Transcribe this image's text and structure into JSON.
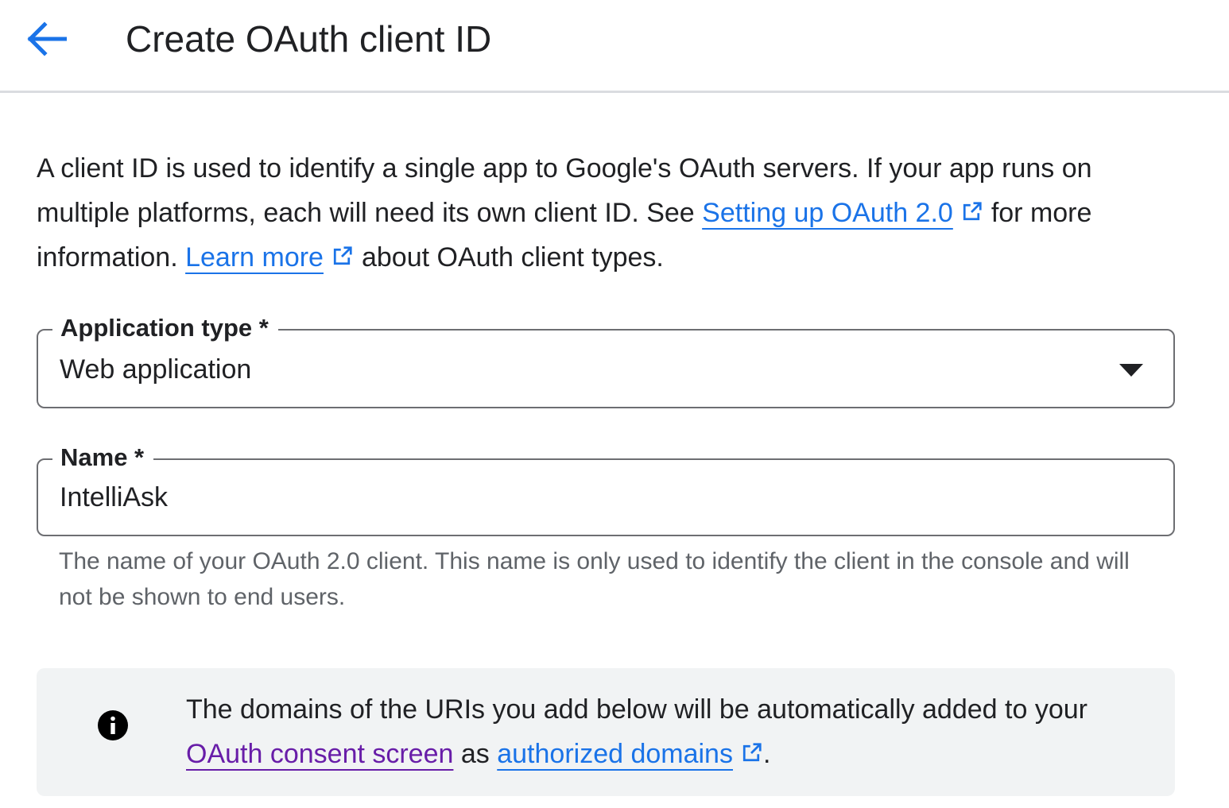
{
  "header": {
    "title": "Create OAuth client ID"
  },
  "intro": {
    "text_1": "A client ID is used to identify a single app to Google's OAuth servers. If your app runs on multiple platforms, each will need its own client ID. See ",
    "link_setup": "Setting up OAuth 2.0",
    "text_2": "for more information. ",
    "link_learn_more": "Learn more",
    "text_3": "about OAuth client types."
  },
  "application_type": {
    "label": "Application type *",
    "value": "Web application"
  },
  "name_field": {
    "label": "Name *",
    "value": "IntelliAsk",
    "helper": "The name of your OAuth 2.0 client. This name is only used to identify the client in the console and will not be shown to end users."
  },
  "info_box": {
    "text_1": "The domains of the URIs you add below will be automatically added to your ",
    "link_consent": "OAuth consent screen",
    "text_2": " as ",
    "link_domains": "authorized domains",
    "text_3": "."
  },
  "colors": {
    "link": "#1a73e8",
    "visited_link": "#681da8",
    "info_bg": "#f1f3f4",
    "outline": "#6d6e72"
  },
  "icons": [
    "arrow-left-icon",
    "external-link-icon",
    "caret-down-icon",
    "info-icon"
  ]
}
